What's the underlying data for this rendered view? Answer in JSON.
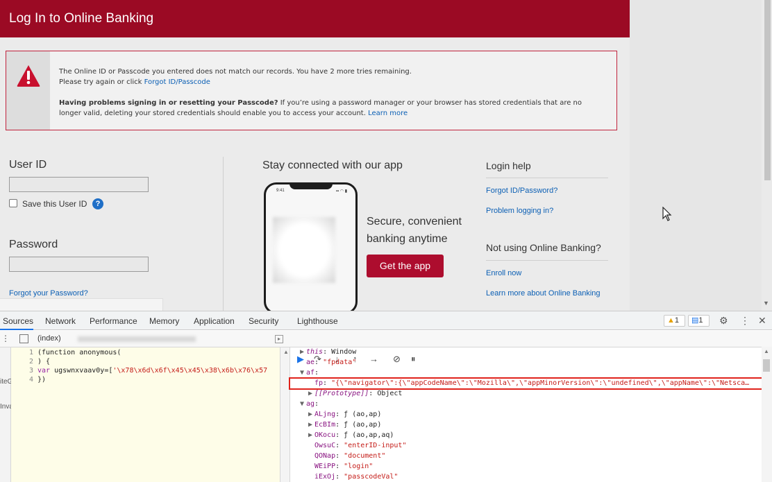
{
  "page": {
    "title": "Log In to Online Banking",
    "error": {
      "line1": "The Online ID or Passcode you entered does not match our records. You have 2 more tries remaining.",
      "line2_prefix": "Please try again or click ",
      "line2_link": "Forgot ID/Passcode",
      "line3_bold": "Having problems signing in or resetting your Passcode?",
      "line3_rest": " If you’re using a password manager or your browser has stored credentials that are no",
      "line4_text": "longer valid, deleting your stored credentials should enable you to access your account. ",
      "line4_link": "Learn more"
    },
    "form": {
      "user_id_label": "User ID",
      "user_id_value": "",
      "save_user_id_label": "Save this User ID",
      "help_glyph": "?",
      "password_label": "Password",
      "password_value": "",
      "forgot_password": "Forgot your Password?"
    },
    "app": {
      "title": "Stay connected with our app",
      "desc_line1": "Secure, convenient",
      "desc_line2": "banking anytime",
      "button": "Get the app",
      "phone_time": "9:41",
      "phone_status": "▪▪ ◠ ▮"
    },
    "help": {
      "login_help_title": "Login help",
      "forgot_id_link": "Forgot ID/Password?",
      "problem_link": "Problem logging in?",
      "not_using_title": "Not using Online Banking?",
      "enroll_link": "Enroll now",
      "learn_more_link": "Learn more about Online Banking"
    }
  },
  "devtools": {
    "tabs": [
      "Sources",
      "Network",
      "Performance",
      "Memory",
      "Application",
      "Security",
      "Lighthouse"
    ],
    "warnings": "1",
    "messages": "1",
    "file_tab": "(index)",
    "left_edge": [
      "iteG",
      "Inva"
    ],
    "code": {
      "line1_num": "1",
      "line1": "(function anonymous(",
      "line2_num": "2",
      "line2": ") {",
      "line3_num": "3",
      "line3_kw": "var",
      "line3_name": " ugswnxvaav0y=[",
      "line3_str": "'\\x78\\x6d\\x6f\\x45\\x45\\x38\\x6b\\x76\\x57",
      "line4_num": "4",
      "line4": "})"
    },
    "scope": {
      "this_key": "this",
      "this_val": ": Window",
      "ae_key": "ae",
      "ae_val": "\"fpdata\"",
      "af_key": "af",
      "fp_key": "fp",
      "fp_val": "\"{\\\"navigator\\\":{\\\"appCodeName\\\":\\\"Mozilla\\\",\\\"appMinorVersion\\\":\\\"undefined\\\",\\\"appName\\\":\\\"Netsca…",
      "proto_key": "[[Prototype]]",
      "proto_val": ": Object",
      "ag_key": "ag",
      "items": [
        {
          "key": "ALjng",
          "val": "ƒ (ao,ap)",
          "expandable": true
        },
        {
          "key": "EcBIm",
          "val": "ƒ (ao,ap)",
          "expandable": true
        },
        {
          "key": "OKocu",
          "val": "ƒ (ao,ap,aq)",
          "expandable": true
        },
        {
          "key": "OwsuC",
          "val": "\"enterID-input\"",
          "expandable": false
        },
        {
          "key": "QONap",
          "val": "\"document\"",
          "expandable": false
        },
        {
          "key": "WEiPP",
          "val": "\"login\"",
          "expandable": false
        },
        {
          "key": "iExOj",
          "val": "\"passcodeVal\"",
          "expandable": false
        }
      ]
    }
  },
  "colors": {
    "brand_red": "#9b0a24",
    "link_blue": "#0b5fb4",
    "highlight_red": "#e0221b"
  }
}
